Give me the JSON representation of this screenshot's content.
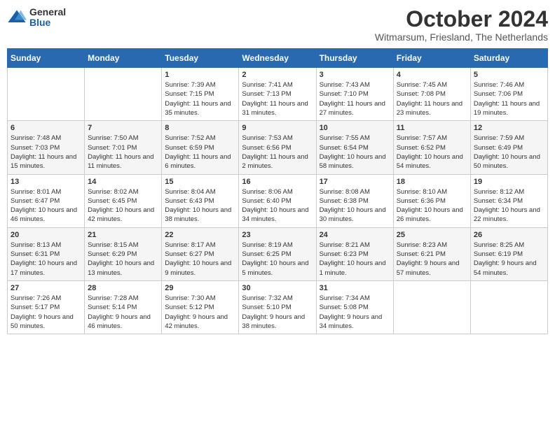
{
  "header": {
    "logo": {
      "general": "General",
      "blue": "Blue"
    },
    "title": "October 2024",
    "location": "Witmarsum, Friesland, The Netherlands"
  },
  "calendar": {
    "weekdays": [
      "Sunday",
      "Monday",
      "Tuesday",
      "Wednesday",
      "Thursday",
      "Friday",
      "Saturday"
    ],
    "weeks": [
      [
        {
          "day": "",
          "info": ""
        },
        {
          "day": "",
          "info": ""
        },
        {
          "day": "1",
          "info": "Sunrise: 7:39 AM\nSunset: 7:15 PM\nDaylight: 11 hours and 35 minutes."
        },
        {
          "day": "2",
          "info": "Sunrise: 7:41 AM\nSunset: 7:13 PM\nDaylight: 11 hours and 31 minutes."
        },
        {
          "day": "3",
          "info": "Sunrise: 7:43 AM\nSunset: 7:10 PM\nDaylight: 11 hours and 27 minutes."
        },
        {
          "day": "4",
          "info": "Sunrise: 7:45 AM\nSunset: 7:08 PM\nDaylight: 11 hours and 23 minutes."
        },
        {
          "day": "5",
          "info": "Sunrise: 7:46 AM\nSunset: 7:06 PM\nDaylight: 11 hours and 19 minutes."
        }
      ],
      [
        {
          "day": "6",
          "info": "Sunrise: 7:48 AM\nSunset: 7:03 PM\nDaylight: 11 hours and 15 minutes."
        },
        {
          "day": "7",
          "info": "Sunrise: 7:50 AM\nSunset: 7:01 PM\nDaylight: 11 hours and 11 minutes."
        },
        {
          "day": "8",
          "info": "Sunrise: 7:52 AM\nSunset: 6:59 PM\nDaylight: 11 hours and 6 minutes."
        },
        {
          "day": "9",
          "info": "Sunrise: 7:53 AM\nSunset: 6:56 PM\nDaylight: 11 hours and 2 minutes."
        },
        {
          "day": "10",
          "info": "Sunrise: 7:55 AM\nSunset: 6:54 PM\nDaylight: 10 hours and 58 minutes."
        },
        {
          "day": "11",
          "info": "Sunrise: 7:57 AM\nSunset: 6:52 PM\nDaylight: 10 hours and 54 minutes."
        },
        {
          "day": "12",
          "info": "Sunrise: 7:59 AM\nSunset: 6:49 PM\nDaylight: 10 hours and 50 minutes."
        }
      ],
      [
        {
          "day": "13",
          "info": "Sunrise: 8:01 AM\nSunset: 6:47 PM\nDaylight: 10 hours and 46 minutes."
        },
        {
          "day": "14",
          "info": "Sunrise: 8:02 AM\nSunset: 6:45 PM\nDaylight: 10 hours and 42 minutes."
        },
        {
          "day": "15",
          "info": "Sunrise: 8:04 AM\nSunset: 6:43 PM\nDaylight: 10 hours and 38 minutes."
        },
        {
          "day": "16",
          "info": "Sunrise: 8:06 AM\nSunset: 6:40 PM\nDaylight: 10 hours and 34 minutes."
        },
        {
          "day": "17",
          "info": "Sunrise: 8:08 AM\nSunset: 6:38 PM\nDaylight: 10 hours and 30 minutes."
        },
        {
          "day": "18",
          "info": "Sunrise: 8:10 AM\nSunset: 6:36 PM\nDaylight: 10 hours and 26 minutes."
        },
        {
          "day": "19",
          "info": "Sunrise: 8:12 AM\nSunset: 6:34 PM\nDaylight: 10 hours and 22 minutes."
        }
      ],
      [
        {
          "day": "20",
          "info": "Sunrise: 8:13 AM\nSunset: 6:31 PM\nDaylight: 10 hours and 17 minutes."
        },
        {
          "day": "21",
          "info": "Sunrise: 8:15 AM\nSunset: 6:29 PM\nDaylight: 10 hours and 13 minutes."
        },
        {
          "day": "22",
          "info": "Sunrise: 8:17 AM\nSunset: 6:27 PM\nDaylight: 10 hours and 9 minutes."
        },
        {
          "day": "23",
          "info": "Sunrise: 8:19 AM\nSunset: 6:25 PM\nDaylight: 10 hours and 5 minutes."
        },
        {
          "day": "24",
          "info": "Sunrise: 8:21 AM\nSunset: 6:23 PM\nDaylight: 10 hours and 1 minute."
        },
        {
          "day": "25",
          "info": "Sunrise: 8:23 AM\nSunset: 6:21 PM\nDaylight: 9 hours and 57 minutes."
        },
        {
          "day": "26",
          "info": "Sunrise: 8:25 AM\nSunset: 6:19 PM\nDaylight: 9 hours and 54 minutes."
        }
      ],
      [
        {
          "day": "27",
          "info": "Sunrise: 7:26 AM\nSunset: 5:17 PM\nDaylight: 9 hours and 50 minutes."
        },
        {
          "day": "28",
          "info": "Sunrise: 7:28 AM\nSunset: 5:14 PM\nDaylight: 9 hours and 46 minutes."
        },
        {
          "day": "29",
          "info": "Sunrise: 7:30 AM\nSunset: 5:12 PM\nDaylight: 9 hours and 42 minutes."
        },
        {
          "day": "30",
          "info": "Sunrise: 7:32 AM\nSunset: 5:10 PM\nDaylight: 9 hours and 38 minutes."
        },
        {
          "day": "31",
          "info": "Sunrise: 7:34 AM\nSunset: 5:08 PM\nDaylight: 9 hours and 34 minutes."
        },
        {
          "day": "",
          "info": ""
        },
        {
          "day": "",
          "info": ""
        }
      ]
    ]
  }
}
